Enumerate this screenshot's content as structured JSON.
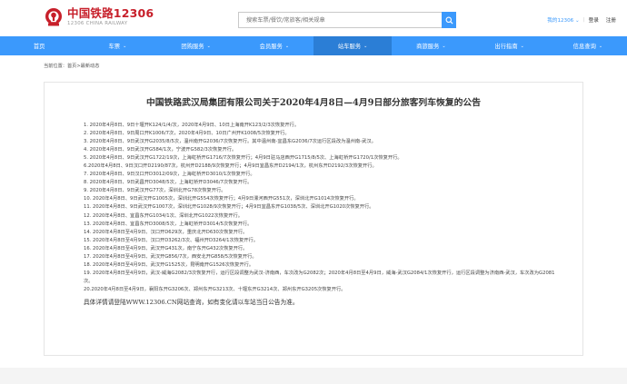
{
  "brand": {
    "name_cn": "中国铁路12306",
    "name_en": "12306 CHINA RAILWAY",
    "color": "#c71f2a"
  },
  "search": {
    "placeholder": "搜索车票/餐饮/常旅客/相关规章",
    "icon": "search-icon"
  },
  "user": {
    "my_label": "我的12306",
    "login_label": "登录",
    "register_label": "注册"
  },
  "nav": {
    "accent": "#3b99fc",
    "items": [
      {
        "label": "首页",
        "chevron": false
      },
      {
        "label": "车票",
        "chevron": true
      },
      {
        "label": "团购服务",
        "chevron": true
      },
      {
        "label": "会员服务",
        "chevron": true
      },
      {
        "label": "站车服务",
        "chevron": true
      },
      {
        "label": "商旅服务",
        "chevron": true
      },
      {
        "label": "出行指南",
        "chevron": true
      },
      {
        "label": "信息查询",
        "chevron": true
      }
    ]
  },
  "breadcrumb": "当前位置：首页>最新动态",
  "article": {
    "title": "中国铁路武汉局集团有限公司关于2020年4月8日—4月9日部分旅客列车恢复的公告",
    "items": [
      "1. 2020年4月8日、9日十堰开K124/1/4/次，2020年4月9日、10日上海南开K123/2/3次恢复开行。",
      "2. 2020年4月8日、9日周口开K1006/7次，2020年4月9日、10日广州开K1008/5次恢复开行。",
      "3. 2020年4月8日、9日武汉开G2035/8/5次，温州南开G2036/7次恢复开行。其中温州南-宜昌东G2036/7次运行区段改为温州南-武汉。",
      "4. 2020年4月8日、9日武汉开G584/1次，宁波开G582/3次恢复开行。",
      "5. 2020年4月8日、9日武汉开G1722/19次，上海虹桥开G1716/7次恢复开行；4月9日驻马店西开G1715/8/5次、上海虹桥开G1720/1次恢复开行。",
      "6.2020年4月8日、9日汉口开D2190/87次，杭州开D2188/9次恢复开行；4月9日宜昌东开D2194/1次，杭州东开D2192/3次恢复开行。",
      "7. 2020年4月8日、9日汉口开D3012/09次，上海虹桥开D3010/1次恢复开行。",
      "8. 2020年4月8日、9日武昌开D3048/5次，上海虹桥开D3046/7次恢复开行。",
      "9. 2020年4月8日、9日武汉开G77次，深圳北开G78次恢复开行。",
      "10. 2020年4月8日、9日武汉开G1005次，深圳北开G554次恢复开行；4月9日漯河西开G551次，深圳北开G1014次恢复开行。",
      "11. 2020年4月8日、9日武汉开G1007次，深圳北开G1028/9次恢复开行；4月9日宜昌东开G1038/5次、深圳北开G1020次恢复开行。",
      "12. 2020年4月8日、宜昌东开G1034/1次、深圳北开G1022次恢复开行。",
      "13. 2020年4月8日、宜昌东开D3008/5次，上海虹桥开D3014/5次恢复开行。",
      "14. 2020年4月8日至4月9日、汉口开D629次，重庆北开D630次恢复开行。",
      "15. 2020年4月8日至4月9日、汉口开D3262/3次、福州开D3264/1次恢复开行。",
      "16. 2020年4月8日至4月9日、武汉开G431次，南宁东开G432次恢复开行。",
      "17. 2020年4月8日至4月9日、武汉开G856/7次，西安北开G858/5次恢复开行。",
      "18. 2020年4月8日至4月9日、武汉开G1525次，昆明南开G1526次恢复开行。",
      "19. 2020年4月8日至4月9日，武汉-威海G2082/3次恢复开行，运行区段调整为武汉-济南西，车次改为G2082次；2020年4月8日至4月9日，威海-武汉G2084/1次恢复开行，运行区段调整为济南西-武汉，车次改为G2081次。",
      "20.2020年4月8日至4月9日，襄阳东开G3206次、郑州东开G3213次、十堰东开G3214次、郑州东开G3205次恢复开行。"
    ],
    "footer": "具体详情请登陆WWW.12306.CN网站查询，如有变化请以车站当日公告为准。"
  }
}
